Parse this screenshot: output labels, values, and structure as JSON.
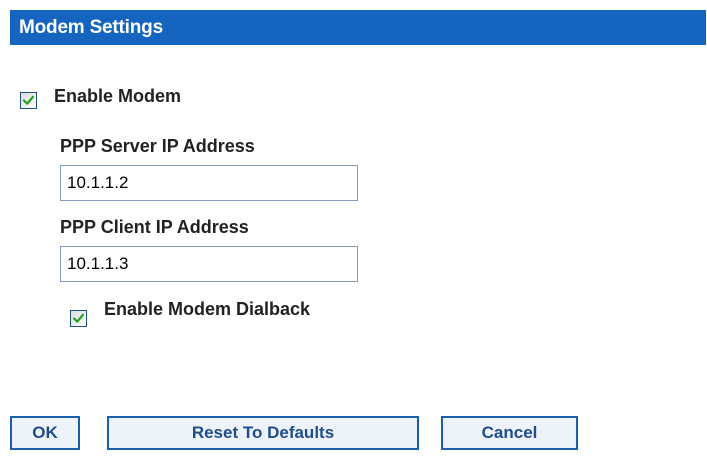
{
  "header": {
    "title": "Modem Settings"
  },
  "form": {
    "enable_modem": {
      "label": "Enable Modem",
      "checked": true
    },
    "ppp_server_ip": {
      "label": "PPP Server IP Address",
      "value": "10.1.1.2"
    },
    "ppp_client_ip": {
      "label": "PPP Client IP Address",
      "value": "10.1.1.3"
    },
    "enable_dialback": {
      "label": "Enable Modem Dialback",
      "checked": true
    }
  },
  "buttons": {
    "ok": "OK",
    "reset": "Reset To Defaults",
    "cancel": "Cancel"
  },
  "colors": {
    "header_bg": "#1565c0",
    "check_mark": "#21a121",
    "button_border": "#1b5fa8",
    "button_text": "#1f4e8c"
  },
  "icons": {
    "checkbox_mark": "check-icon"
  }
}
